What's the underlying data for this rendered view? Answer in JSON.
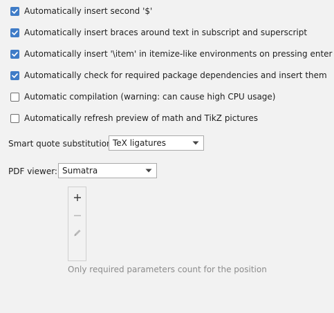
{
  "checkboxes": [
    {
      "label": "Automatically insert second '$'",
      "checked": true
    },
    {
      "label": "Automatically insert braces around text in subscript and superscript",
      "checked": true
    },
    {
      "label": "Automatically insert '\\item' in itemize-like environments on pressing enter",
      "checked": true
    },
    {
      "label": "Automatically check for required package dependencies and insert them",
      "checked": true
    },
    {
      "label": "Automatic compilation (warning: can cause high CPU usage)",
      "checked": false
    },
    {
      "label": "Automatically refresh preview of math and TikZ pictures",
      "checked": false
    }
  ],
  "smart_quote": {
    "label": "Smart quote substitution:",
    "value": "TeX ligatures"
  },
  "pdf_viewer": {
    "label": "PDF viewer:",
    "value": "Sumatra"
  },
  "toolbar": {
    "buttons": [
      {
        "icon": "plus-icon",
        "enabled": true
      },
      {
        "icon": "minus-icon",
        "enabled": false
      },
      {
        "icon": "pencil-icon",
        "enabled": false
      }
    ]
  },
  "hint": "Only required parameters count for the position",
  "colors": {
    "accent": "#3f7cc7",
    "background": "#f2f2f2",
    "disabled_text": "#8c8c8c"
  }
}
